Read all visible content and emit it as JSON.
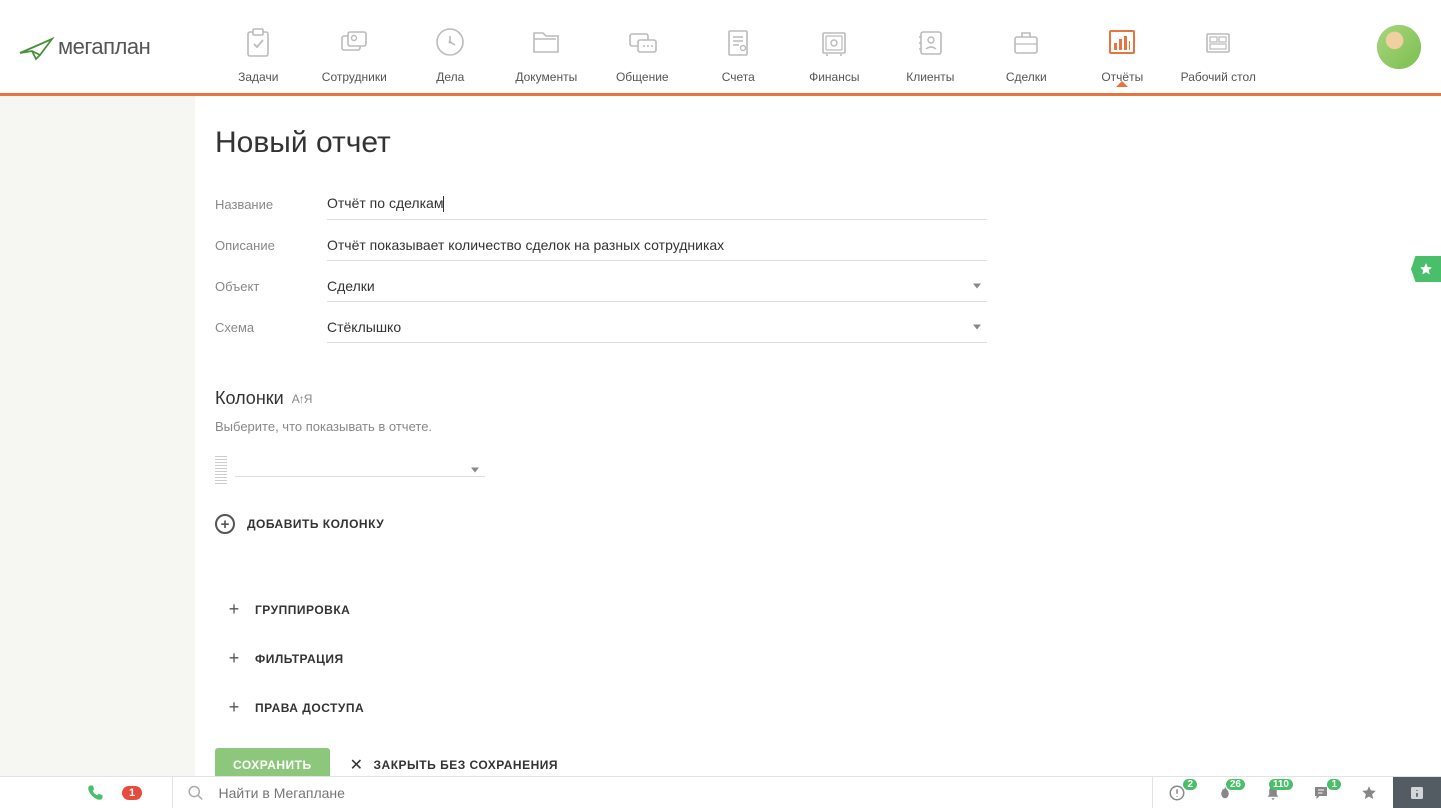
{
  "brand": "мегаплан",
  "nav": {
    "items": [
      {
        "label": "Задачи"
      },
      {
        "label": "Сотрудники"
      },
      {
        "label": "Дела"
      },
      {
        "label": "Документы"
      },
      {
        "label": "Общение"
      },
      {
        "label": "Счета"
      },
      {
        "label": "Финансы"
      },
      {
        "label": "Клиенты"
      },
      {
        "label": "Сделки"
      },
      {
        "label": "Отчёты"
      },
      {
        "label": "Рабочий стол"
      }
    ],
    "active_index": 9
  },
  "page": {
    "title": "Новый отчет"
  },
  "form": {
    "name_label": "Название",
    "name_value": "Отчёт по сделкам",
    "description_label": "Описание",
    "description_value": "Отчёт показывает количество сделок на разных сотрудниках",
    "object_label": "Объект",
    "object_value": "Сделки",
    "scheme_label": "Схема",
    "scheme_value": "Стёклышко"
  },
  "columns": {
    "title": "Колонки",
    "sort_hint": "А↑Я",
    "subtitle": "Выберите, что показывать в отчете.",
    "add_label": "ДОБАВИТЬ КОЛОНКУ"
  },
  "sections": {
    "grouping": "ГРУППИРОВКА",
    "filtering": "ФИЛЬТРАЦИЯ",
    "permissions": "ПРАВА ДОСТУПА"
  },
  "actions": {
    "save": "СОХРАНИТЬ",
    "cancel": "ЗАКРЫТЬ БЕЗ СОХРАНЕНИЯ"
  },
  "bottombar": {
    "phone_badge": "1",
    "search_placeholder": "Найти в Мегаплане",
    "alerts_badge": "2",
    "fire_badge": "26",
    "bell_badge": "110",
    "chat_badge": "1"
  }
}
